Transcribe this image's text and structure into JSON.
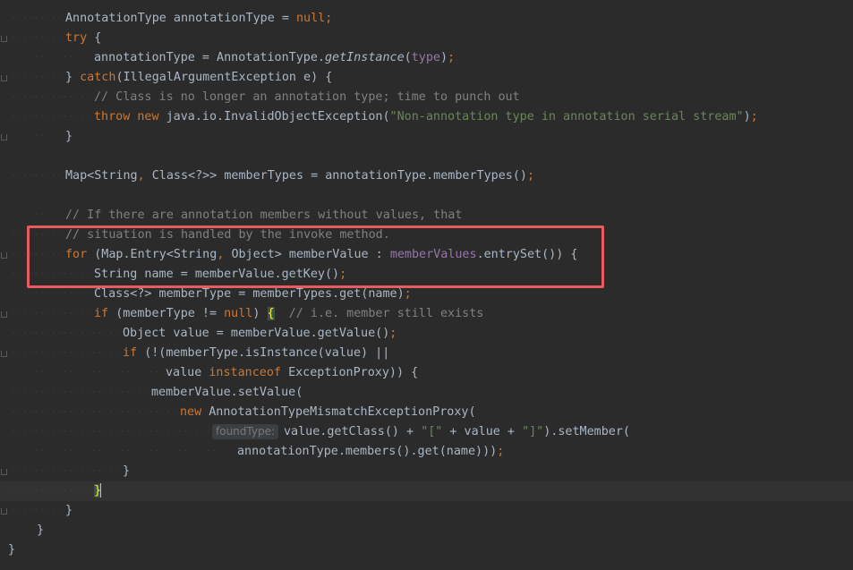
{
  "editor": {
    "lines": [
      {
        "tokens": [
          {
            "t": "AnnotationType annotationType ",
            "c": "plain"
          },
          {
            "t": "= ",
            "c": "plain"
          },
          {
            "t": "null",
            "c": "kw"
          },
          {
            "t": ";",
            "c": "kw"
          }
        ]
      },
      {
        "tokens": [
          {
            "t": "try ",
            "c": "kw"
          },
          {
            "t": "{",
            "c": "plain"
          }
        ]
      },
      {
        "tokens": [
          {
            "t": "annotationType = AnnotationType.",
            "c": "plain"
          },
          {
            "t": "getInstance",
            "c": "it"
          },
          {
            "t": "(",
            "c": "plain"
          },
          {
            "t": "type",
            "c": "fld"
          },
          {
            "t": ")",
            "c": "plain"
          },
          {
            "t": ";",
            "c": "kw"
          }
        ]
      },
      {
        "tokens": [
          {
            "t": "} ",
            "c": "plain"
          },
          {
            "t": "catch",
            "c": "kw"
          },
          {
            "t": "(IllegalArgumentException e) {",
            "c": "plain"
          }
        ]
      },
      {
        "tokens": [
          {
            "t": "// Class is no longer an annotation type; time to punch out",
            "c": "cmt"
          }
        ]
      },
      {
        "tokens": [
          {
            "t": "throw new ",
            "c": "kw"
          },
          {
            "t": "java.io.InvalidObjectException(",
            "c": "plain"
          },
          {
            "t": "\"Non-annotation type in annotation serial stream\"",
            "c": "str"
          },
          {
            "t": ")",
            "c": "plain"
          },
          {
            "t": ";",
            "c": "kw"
          }
        ]
      },
      {
        "tokens": [
          {
            "t": "}",
            "c": "plain"
          }
        ]
      },
      {
        "tokens": []
      },
      {
        "tokens": [
          {
            "t": "Map<String",
            "c": "plain"
          },
          {
            "t": ", ",
            "c": "kw"
          },
          {
            "t": "Class<?>> memberTypes = annotationType.memberTypes()",
            "c": "plain"
          },
          {
            "t": ";",
            "c": "kw"
          }
        ]
      },
      {
        "tokens": []
      },
      {
        "tokens": [
          {
            "t": "// If there are annotation members without values, that",
            "c": "cmt"
          }
        ]
      },
      {
        "tokens": [
          {
            "t": "// situation is handled by the invoke method.",
            "c": "cmt"
          }
        ]
      },
      {
        "tokens": [
          {
            "t": "for ",
            "c": "kw"
          },
          {
            "t": "(Map.Entry<String",
            "c": "plain"
          },
          {
            "t": ", ",
            "c": "kw"
          },
          {
            "t": "Object> memberValue : ",
            "c": "plain"
          },
          {
            "t": "memberValues",
            "c": "fld"
          },
          {
            "t": ".entrySet()) {",
            "c": "plain"
          }
        ]
      },
      {
        "tokens": [
          {
            "t": "String name = memberValue.getKey()",
            "c": "plain"
          },
          {
            "t": ";",
            "c": "kw"
          }
        ]
      },
      {
        "tokens": [
          {
            "t": "Class<?> memberType = memberTypes.get(name)",
            "c": "plain"
          },
          {
            "t": ";",
            "c": "kw"
          }
        ]
      },
      {
        "tokens": [
          {
            "t": "if ",
            "c": "kw"
          },
          {
            "t": "(memberType != ",
            "c": "plain"
          },
          {
            "t": "null",
            "c": "kw"
          },
          {
            "t": ") ",
            "c": "plain"
          },
          {
            "t": "{",
            "c": "brace-hl"
          },
          {
            "t": "  // i.e. member still exists",
            "c": "cmt"
          }
        ]
      },
      {
        "tokens": [
          {
            "t": "Object value = memberValue.getValue()",
            "c": "plain"
          },
          {
            "t": ";",
            "c": "kw"
          }
        ]
      },
      {
        "tokens": [
          {
            "t": "if ",
            "c": "kw"
          },
          {
            "t": "(!(memberType.isInstance(value) ||",
            "c": "plain"
          }
        ]
      },
      {
        "tokens": [
          {
            "t": "value ",
            "c": "plain"
          },
          {
            "t": "instanceof ",
            "c": "kw"
          },
          {
            "t": "ExceptionProxy)) {",
            "c": "plain"
          }
        ]
      },
      {
        "tokens": [
          {
            "t": "memberValue.setValue(",
            "c": "plain"
          }
        ]
      },
      {
        "tokens": [
          {
            "t": "new ",
            "c": "kw"
          },
          {
            "t": "AnnotationTypeMismatchExceptionProxy(",
            "c": "plain"
          }
        ]
      },
      {
        "hint": "foundType:",
        "tokens": [
          {
            "t": "value.getClass() + ",
            "c": "plain"
          },
          {
            "t": "\"[\"",
            "c": "str"
          },
          {
            "t": " + value + ",
            "c": "plain"
          },
          {
            "t": "\"]\"",
            "c": "str"
          },
          {
            "t": ").setMember(",
            "c": "plain"
          }
        ]
      },
      {
        "tokens": [
          {
            "t": "annotationType.members().get(name)))",
            "c": "plain"
          },
          {
            "t": ";",
            "c": "kw"
          }
        ]
      },
      {
        "tokens": [
          {
            "t": "}",
            "c": "plain"
          }
        ]
      },
      {
        "tokens": [
          {
            "t": "}",
            "c": "brace-hl"
          }
        ]
      },
      {
        "tokens": [
          {
            "t": "}",
            "c": "plain"
          }
        ]
      },
      {
        "tokens": [
          {
            "t": "}",
            "c": "plain"
          }
        ]
      },
      {
        "tokens": [
          {
            "t": "}",
            "c": "plain"
          }
        ]
      }
    ]
  },
  "colors": {
    "background": "#2b2b2b",
    "highlight_box": "#e85b5f",
    "keyword": "#cc7832",
    "string": "#6a8759",
    "comment": "#808080",
    "field": "#9876aa"
  }
}
